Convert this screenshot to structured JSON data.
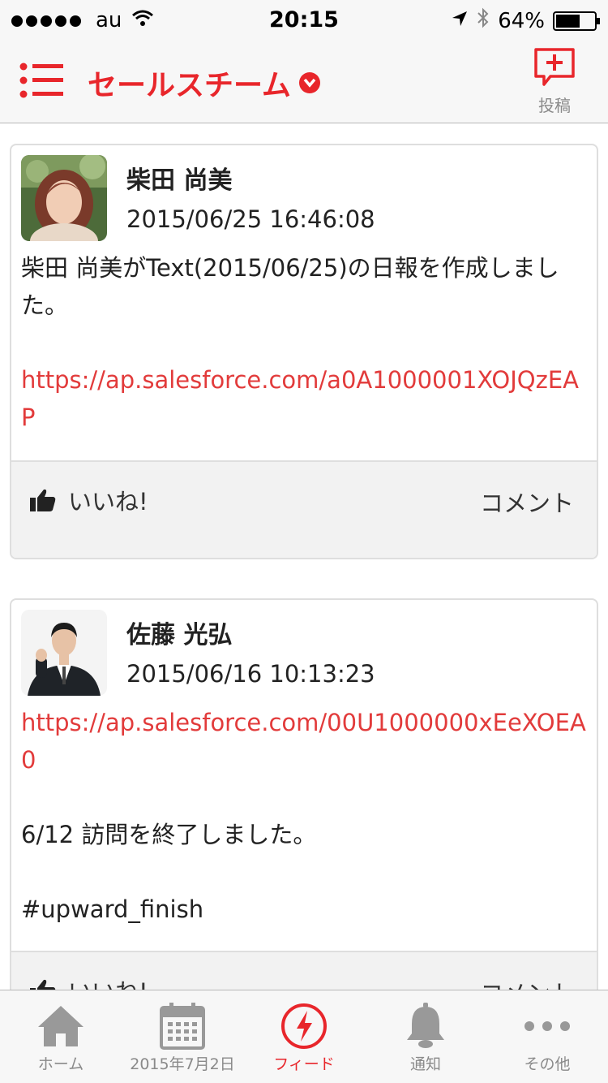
{
  "status_bar": {
    "carrier": "au",
    "time": "20:15",
    "battery": "64%",
    "battery_level": 0.64
  },
  "nav": {
    "title": "セールスチーム",
    "post_label": "投稿"
  },
  "posts": [
    {
      "author": "柴田 尚美",
      "timestamp": "2015/06/25 16:46:08",
      "text": "柴田 尚美がText(2015/06/25)の日報を作成しました。",
      "link": "https://ap.salesforce.com/a0A1000001XOJQzEAP",
      "like_label": "いいね!",
      "comment_label": "コメント"
    },
    {
      "author": "佐藤 光弘",
      "timestamp": "2015/06/16 10:13:23",
      "link": "https://ap.salesforce.com/00U1000000xEeXOEA0",
      "text": "6/12 訪問を終了しました。",
      "hashtag": "#upward_finish",
      "like_label": "いいね!",
      "comment_label": "コメント"
    }
  ],
  "tabs": [
    {
      "label": "ホーム",
      "icon": "home-icon"
    },
    {
      "label": "2015年7月2日",
      "icon": "calendar-icon"
    },
    {
      "label": "フィード",
      "icon": "feed-icon"
    },
    {
      "label": "通知",
      "icon": "bell-icon"
    },
    {
      "label": "その他",
      "icon": "more-icon"
    }
  ],
  "colors": {
    "accent": "#e8262b",
    "link": "#e23b3b",
    "inactive": "#8a8a8a"
  }
}
